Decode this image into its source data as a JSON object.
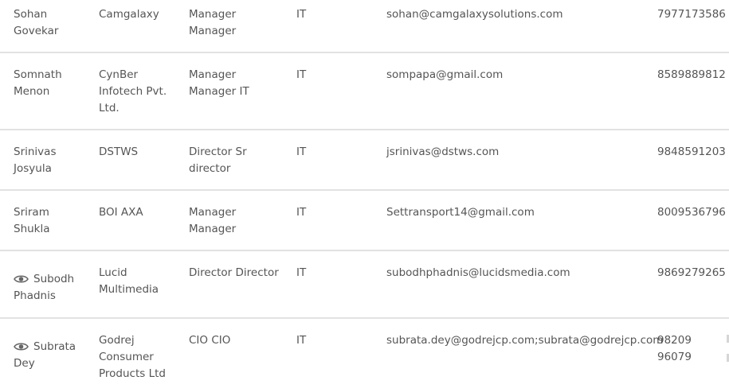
{
  "rows": [
    {
      "name_l1": "Sohan",
      "name_l2": "Govekar",
      "viewed": false,
      "company_l1": "Camgalaxy",
      "company_l2": "",
      "company_l3": "",
      "designation_l1": "Manager",
      "designation_l2": "Manager",
      "department": "IT",
      "email": "sohan@camgalaxysolutions.com",
      "phone_l1": "7977173586",
      "phone_l2": ""
    },
    {
      "name_l1": "Somnath",
      "name_l2": "Menon",
      "viewed": false,
      "company_l1": "CynBer",
      "company_l2": "Infotech Pvt.",
      "company_l3": "Ltd.",
      "designation_l1": "Manager",
      "designation_l2": "Manager IT",
      "department": "IT",
      "email": "sompapa@gmail.com",
      "phone_l1": "8589889812",
      "phone_l2": ""
    },
    {
      "name_l1": "Srinivas",
      "name_l2": "Josyula",
      "viewed": false,
      "company_l1": "DSTWS",
      "company_l2": "",
      "company_l3": "",
      "designation_l1": "Director Sr",
      "designation_l2": "director",
      "department": "IT",
      "email": "jsrinivas@dstws.com",
      "phone_l1": "9848591203",
      "phone_l2": ""
    },
    {
      "name_l1": "Sriram",
      "name_l2": "Shukla",
      "viewed": false,
      "company_l1": "BOI AXA",
      "company_l2": "",
      "company_l3": "",
      "designation_l1": "Manager",
      "designation_l2": "Manager",
      "department": "IT",
      "email": "Settransport14@gmail.com",
      "phone_l1": "8009536796",
      "phone_l2": ""
    },
    {
      "name_l1": "Subodh",
      "name_l2": "Phadnis",
      "viewed": true,
      "company_l1": "Lucid",
      "company_l2": "Multimedia",
      "company_l3": "",
      "designation_l1": "Director Director",
      "designation_l2": "",
      "department": "IT",
      "email": "subodhphadnis@lucidsmedia.com",
      "phone_l1": "9869279265",
      "phone_l2": ""
    },
    {
      "name_l1": "Subrata",
      "name_l2": "Dey",
      "viewed": true,
      "company_l1": "Godrej",
      "company_l2": "Consumer",
      "company_l3": "Products Ltd",
      "designation_l1": "CIO CIO",
      "designation_l2": "",
      "department": "IT",
      "email": "subrata.dey@godrejcp.com;subrata@godrejcp.com",
      "phone_l1": "98209",
      "phone_l2": "96079"
    }
  ],
  "icons": {
    "viewed": "eye-icon"
  }
}
